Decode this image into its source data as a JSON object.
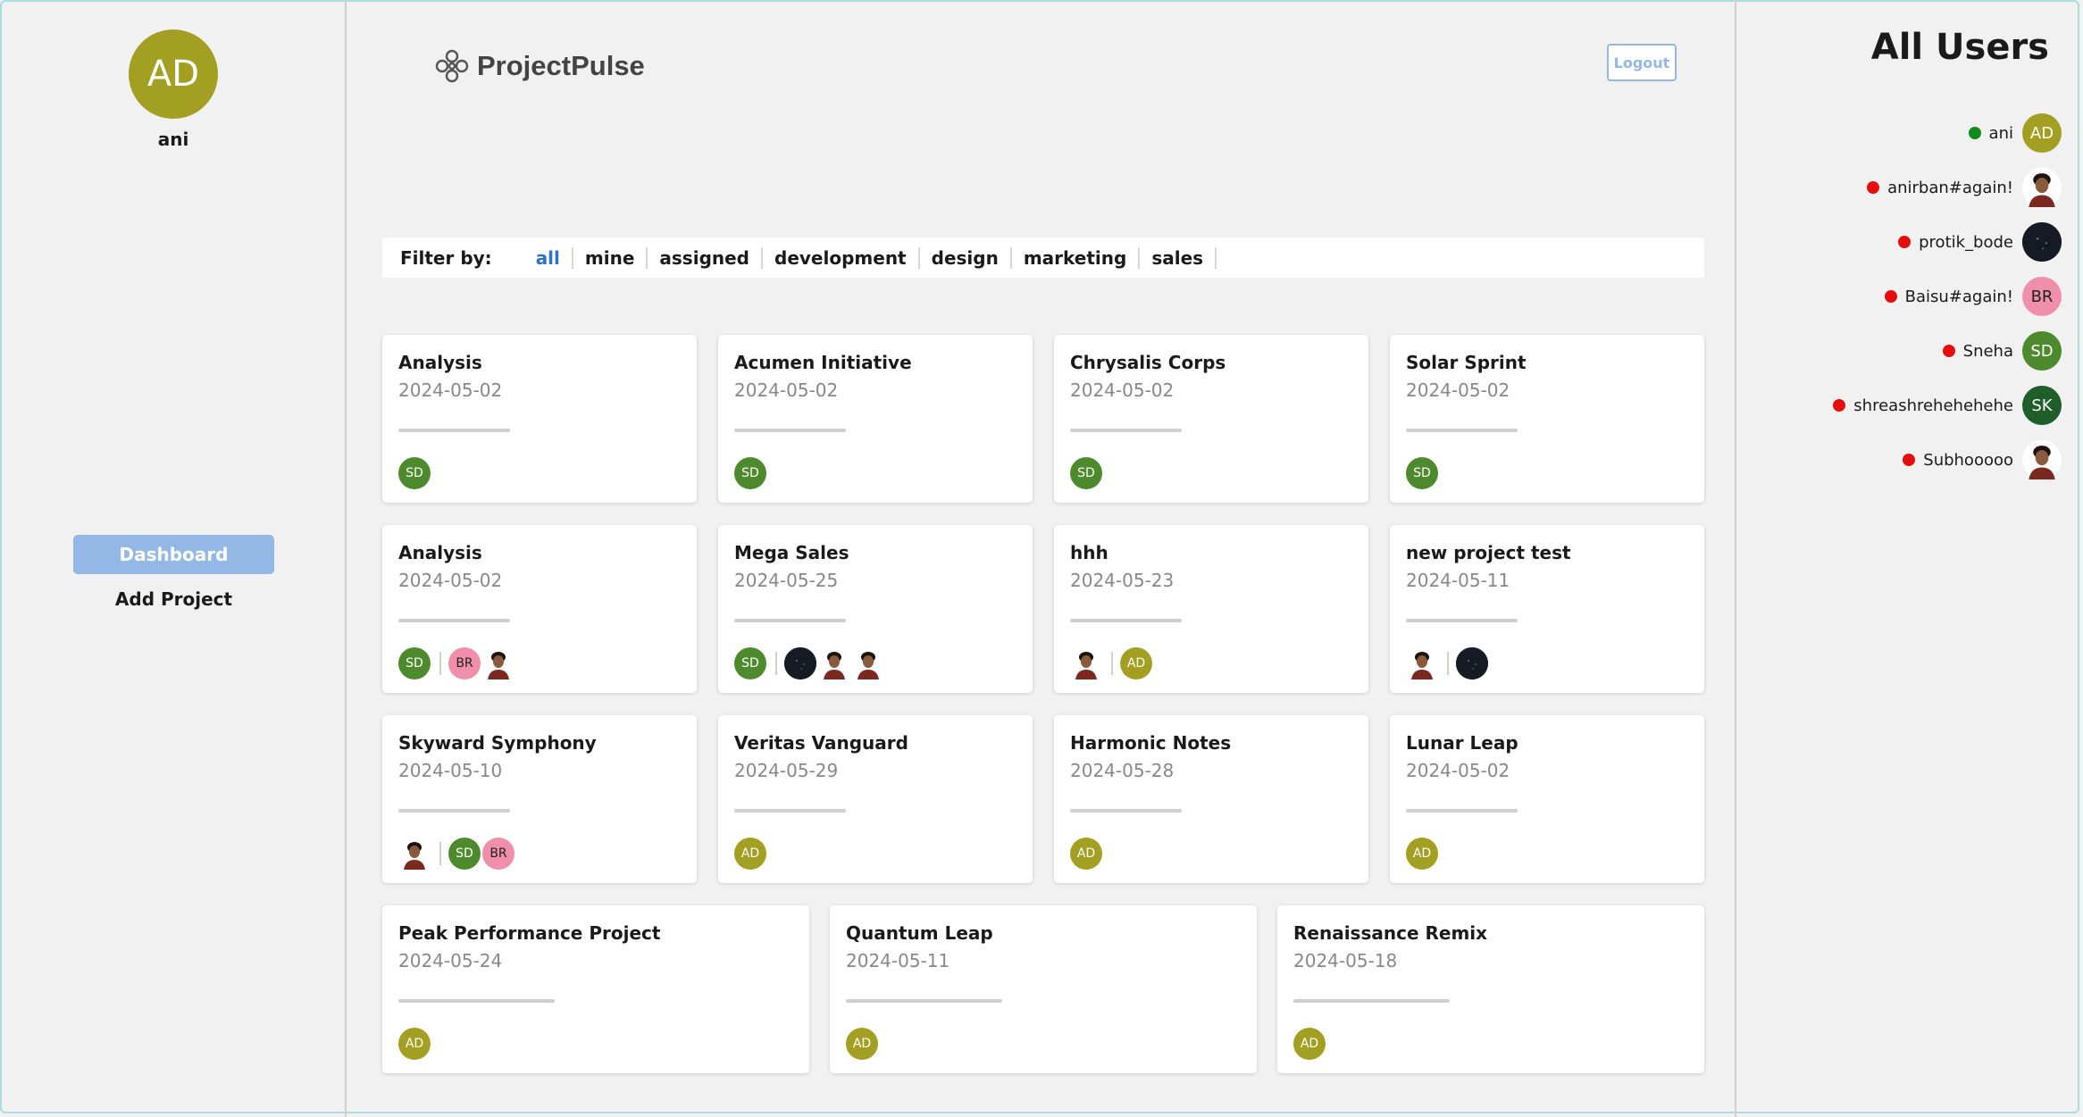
{
  "profile": {
    "initials": "AD",
    "name": "ani"
  },
  "nav": {
    "dashboard": "Dashboard",
    "add_project": "Add Project"
  },
  "header": {
    "app_name": "ProjectPulse",
    "logout": "Logout"
  },
  "filter": {
    "label": "Filter by:",
    "items": [
      "all",
      "mine",
      "assigned",
      "development",
      "design",
      "marketing",
      "sales"
    ],
    "active": "all"
  },
  "projects": [
    {
      "title": "Analysis",
      "date": "2024-05-02",
      "members": [
        "SD"
      ]
    },
    {
      "title": "Acumen Initiative",
      "date": "2024-05-02",
      "members": [
        "SD"
      ]
    },
    {
      "title": "Chrysalis Corps",
      "date": "2024-05-02",
      "members": [
        "SD"
      ]
    },
    {
      "title": "Solar Sprint",
      "date": "2024-05-02",
      "members": [
        "SD"
      ]
    },
    {
      "title": "Analysis",
      "date": "2024-05-02",
      "members": [
        "SD",
        "BR",
        "photo"
      ]
    },
    {
      "title": "Mega Sales",
      "date": "2024-05-25",
      "members": [
        "SD",
        "dark",
        "photo",
        "photo"
      ]
    },
    {
      "title": "hhh",
      "date": "2024-05-23",
      "members": [
        "photo",
        "AD"
      ]
    },
    {
      "title": "new project test",
      "date": "2024-05-11",
      "members": [
        "photo",
        "dark"
      ]
    },
    {
      "title": "Skyward Symphony",
      "date": "2024-05-10",
      "members": [
        "photo",
        "SD",
        "BR"
      ]
    },
    {
      "title": "Veritas Vanguard",
      "date": "2024-05-29",
      "members": [
        "AD"
      ]
    },
    {
      "title": "Harmonic Notes",
      "date": "2024-05-28",
      "members": [
        "AD"
      ]
    },
    {
      "title": "Lunar Leap",
      "date": "2024-05-02",
      "members": [
        "AD"
      ]
    },
    {
      "title": "Peak Performance Project",
      "date": "2024-05-24",
      "members": [
        "AD"
      ]
    },
    {
      "title": "Quantum Leap",
      "date": "2024-05-11",
      "members": [
        "AD"
      ]
    },
    {
      "title": "Renaissance Remix",
      "date": "2024-05-18",
      "members": [
        "AD"
      ]
    }
  ],
  "users_panel": {
    "title": "All Users",
    "users": [
      {
        "name": "ani",
        "status": "online",
        "avatar": "AD"
      },
      {
        "name": "anirban#again!",
        "status": "offline",
        "avatar": "photo"
      },
      {
        "name": "protik_bode",
        "status": "offline",
        "avatar": "dark"
      },
      {
        "name": "Baisu#again!",
        "status": "offline",
        "avatar": "BR"
      },
      {
        "name": "Sneha",
        "status": "offline",
        "avatar": "SD"
      },
      {
        "name": "shreashrehehehehe",
        "status": "offline",
        "avatar": "SK"
      },
      {
        "name": "Subhooooo",
        "status": "offline",
        "avatar": "photo"
      }
    ]
  },
  "colors": {
    "online": "#0f8a1d",
    "offline": "#e50d0d",
    "accent": "#93b8e6",
    "active_filter": "#2f6fd0",
    "sd": "#4d8a2d",
    "ad": "#a39f22",
    "br": "#f08fab",
    "sk": "#1f5e2b"
  }
}
